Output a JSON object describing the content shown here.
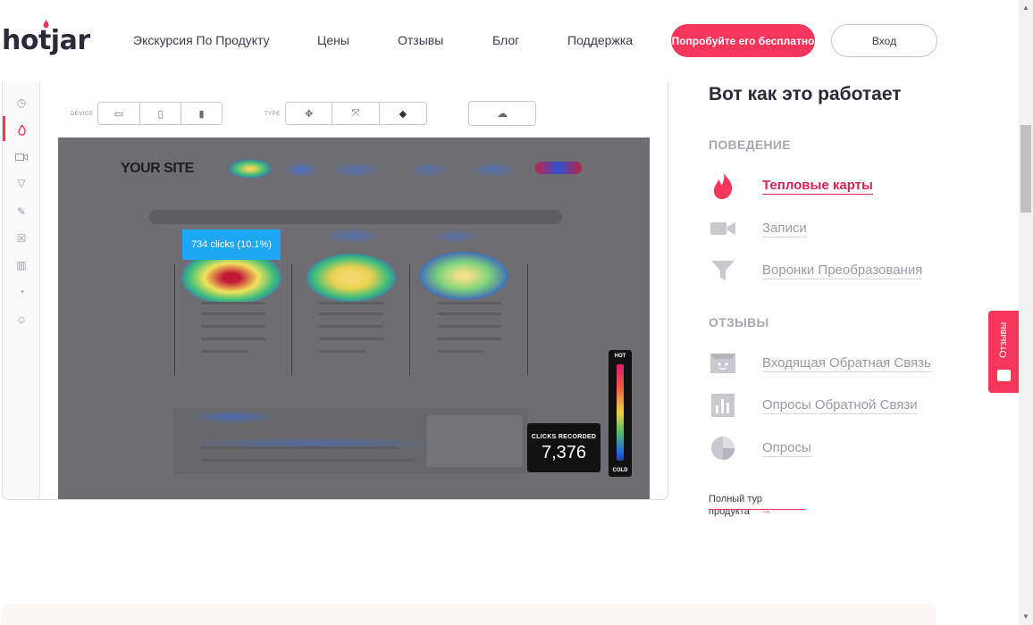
{
  "header": {
    "logo": "hotjar",
    "nav": [
      "Экскурсия По Продукту",
      "Цены",
      "Отзывы",
      "Блог",
      "Поддержка"
    ],
    "cta_label": "Попробуйте его бесплатно",
    "login_label": "Вход"
  },
  "app": {
    "toolbar": {
      "device_label": "DEVICE",
      "type_label": "TYPE"
    },
    "stage": {
      "site_logo": "YOUR SITE",
      "tooltip": "734 clicks (10.1%)",
      "clicks_label": "CLICKS RECORDED",
      "clicks_value": "7,376",
      "scale_hot": "HOT",
      "scale_cold": "COLD"
    }
  },
  "panel": {
    "title": "Вот как это работает",
    "section_behavior": "ПОВЕДЕНИЕ",
    "behavior_items": [
      {
        "label": "Тепловые карты",
        "icon": "flame-icon",
        "active": true
      },
      {
        "label": "Записи",
        "icon": "video-camera-icon",
        "active": false
      },
      {
        "label": "Воронки Преобразования",
        "icon": "funnel-icon",
        "active": false
      }
    ],
    "section_feedback": "ОТЗЫВЫ",
    "feedback_items": [
      {
        "label": "Входящая Обратная Связь",
        "icon": "feedback-face-icon"
      },
      {
        "label": "Опросы Обратной Связи",
        "icon": "bar-chart-icon"
      },
      {
        "label": "Опросы",
        "icon": "pie-chart-icon"
      }
    ],
    "tour_link": "Полный тур продукта"
  },
  "feedback_tab": {
    "label": "Отзывы"
  },
  "colors": {
    "brand": "#f4365a",
    "active_text": "#d42550",
    "muted": "#9a9aa4"
  }
}
